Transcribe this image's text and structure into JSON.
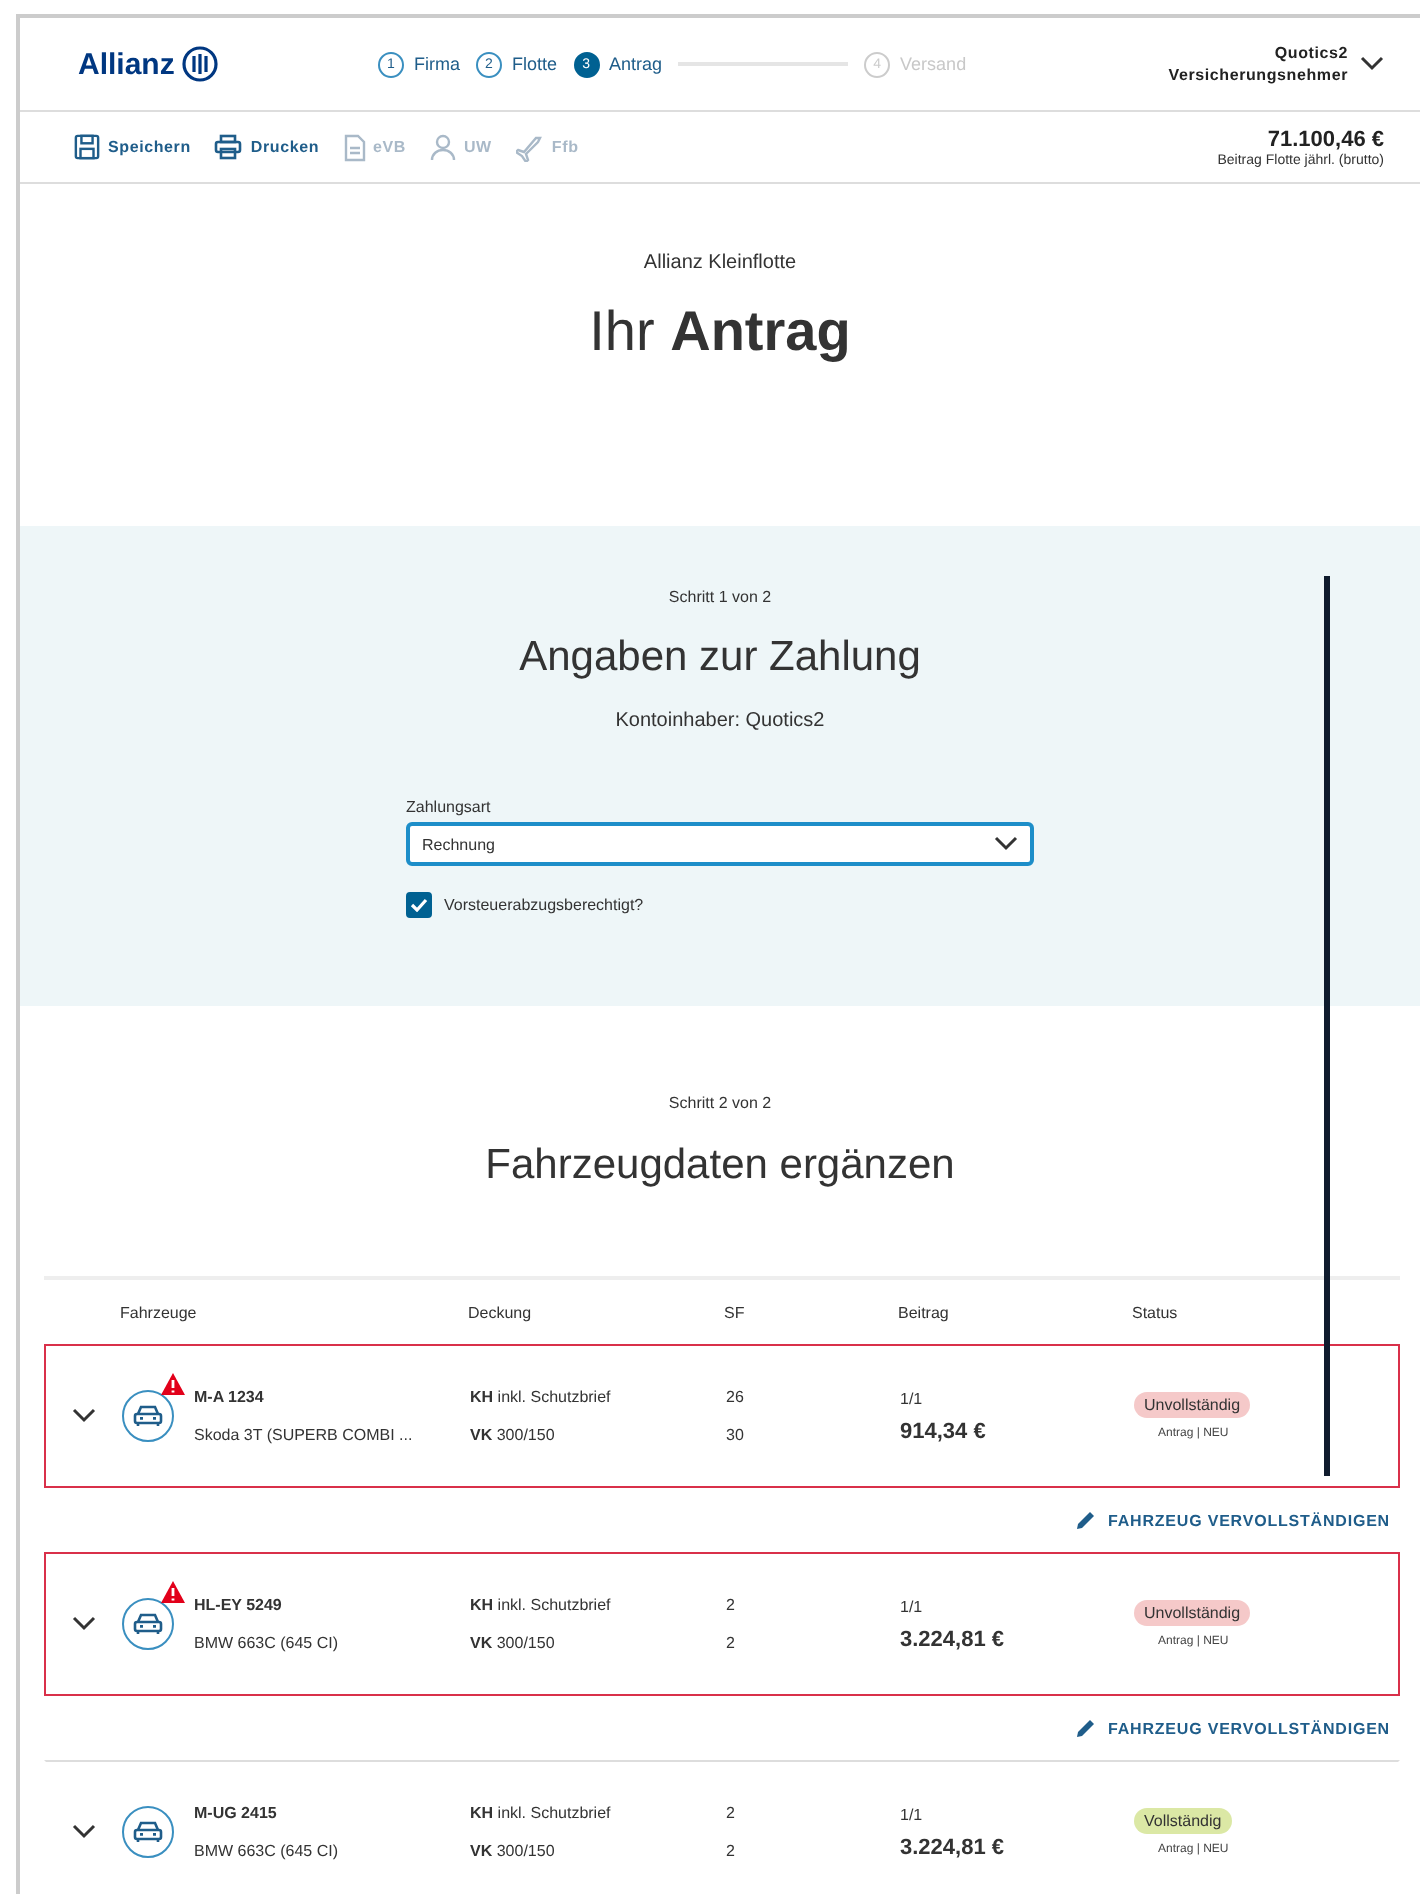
{
  "header": {
    "logo": "Allianz",
    "steps": [
      {
        "number": "1",
        "label": "Firma",
        "selected": false,
        "disabled": false
      },
      {
        "number": "2",
        "label": "Flotte",
        "selected": false,
        "disabled": false
      },
      {
        "number": "3",
        "label": "Antrag",
        "selected": true,
        "disabled": false
      },
      {
        "number": "4",
        "label": "Versand",
        "selected": false,
        "disabled": true
      }
    ],
    "user": {
      "name": "Quotics2",
      "role": "Versicherungsnehmer"
    }
  },
  "toolbar": {
    "items": [
      {
        "label": "Speichern",
        "disabled": false
      },
      {
        "label": "Drucken",
        "disabled": false
      },
      {
        "label": "eVB",
        "disabled": true
      },
      {
        "label": "UW",
        "disabled": true
      },
      {
        "label": "Ffb",
        "disabled": true
      }
    ],
    "total": "71.100,46 €",
    "total_label": "Beitrag Flotte jährl. (brutto)"
  },
  "intro": {
    "subtitle": "Allianz Kleinflotte",
    "title": "Ihr **Antrag**"
  },
  "payment": {
    "step": "Schritt 1 von 2",
    "title": "Angaben zur Zahlung",
    "account_holder": "Kontoinhaber: Quotics2",
    "field_label": "Zahlungsart",
    "field_value": "Rechnung",
    "checkbox": {
      "label": "Vorsteuerabzugsberechtigt?",
      "checked": true
    }
  },
  "vehicles": {
    "step": "Schritt 2 von 2",
    "title": "Fahrzeugdaten ergänzen",
    "columns": [
      "Fahrzeuge",
      "Deckung",
      "SF",
      "Beitrag",
      "Status"
    ],
    "rows": [
      {
        "plate": "M-A 1234",
        "model": "Skoda 3T (SUPERB COMBI ...",
        "coverage": [
          "**KH** inkl. Schutzbrief",
          "**VK** 300/150"
        ],
        "sf": [
          "26",
          "30"
        ],
        "rate": "1/1",
        "premium": "914,34 €",
        "status": "Unvollständig",
        "complete": false,
        "status_note": "Antrag | NEU",
        "warning": true,
        "action": "FAHRZEUG VERVOLLSTÄNDIGEN"
      },
      {
        "plate": "HL-EY 5249",
        "model": "BMW 663C (645 CI)",
        "coverage": [
          "**KH** inkl. Schutzbrief",
          "**VK** 300/150"
        ],
        "sf": [
          "2",
          "2"
        ],
        "rate": "1/1",
        "premium": "3.224,81 €",
        "status": "Unvollständig",
        "complete": false,
        "status_note": "Antrag | NEU",
        "warning": true,
        "action": "FAHRZEUG VERVOLLSTÄNDIGEN"
      },
      {
        "plate": "M-UG 2415",
        "model": "BMW 663C (645 CI)",
        "coverage": [
          "**KH** inkl. Schutzbrief",
          "**VK** 300/150"
        ],
        "sf": [
          "2",
          "2"
        ],
        "rate": "1/1",
        "premium": "3.224,81 €",
        "status": "Vollständig",
        "complete": true,
        "status_note": "Antrag | NEU",
        "warning": false
      }
    ]
  }
}
